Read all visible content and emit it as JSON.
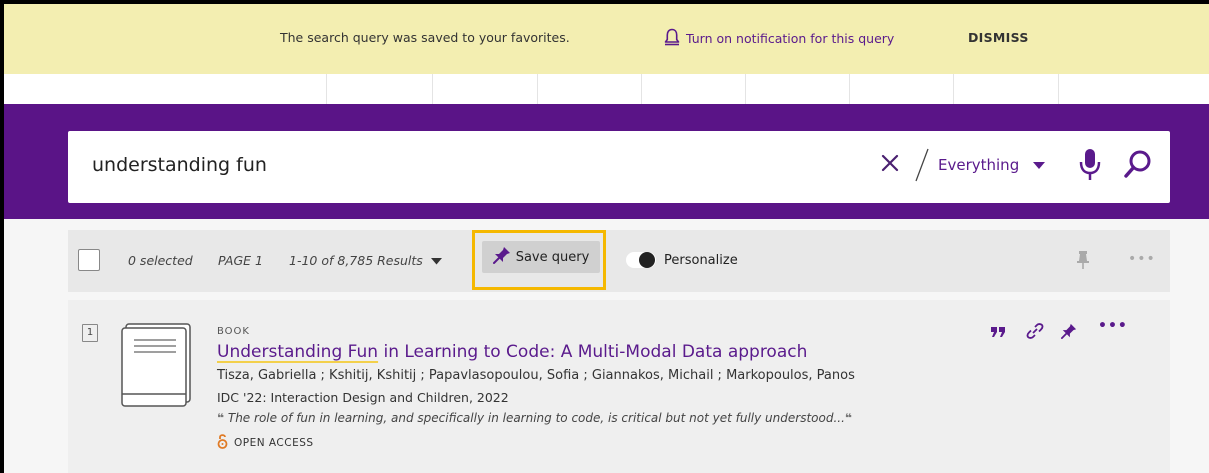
{
  "notification": {
    "message": "The search query was saved to your favorites.",
    "notify_label": "Turn on notification for this query",
    "dismiss_label": "DISMISS"
  },
  "search": {
    "query": "understanding fun",
    "scope": "Everything"
  },
  "toolbar": {
    "selected": "0 selected",
    "page": "PAGE 1",
    "results": "1-10 of 8,785 Results",
    "save_query": "Save query",
    "personalize": "Personalize"
  },
  "result": {
    "number": "1",
    "type": "BOOK",
    "title_highlight": "Understanding Fun",
    "title_rest": " in Learning to Code: A Multi-Modal Data approach",
    "authors": "Tisza, Gabriella ; Kshitij, Kshitij ; Papavlasopoulou, Sofia ; Giannakos, Michail ; Markopoulos, Panos",
    "publication": "IDC '22: Interaction Design and Children, 2022",
    "snippet": "The role of fun in learning, and specifically in learning to code, is critical but not yet fully understood...",
    "access": "OPEN ACCESS"
  },
  "colors": {
    "brand_purple": "#5a1487",
    "notification_bg": "#f3eeb1",
    "highlight_border": "#f5b800",
    "open_access": "#e07b26"
  },
  "icons": [
    "bell-icon",
    "clear-icon",
    "chevron-down-icon",
    "microphone-icon",
    "search-icon",
    "pin-icon",
    "more-icon",
    "quote-icon",
    "link-icon",
    "open-access-icon",
    "book-thumbnail-icon"
  ]
}
